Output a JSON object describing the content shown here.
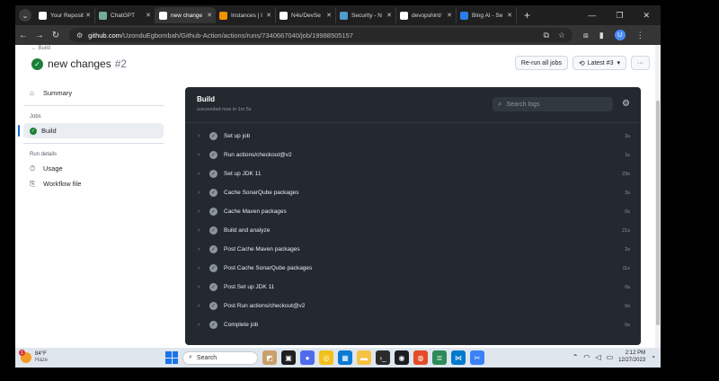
{
  "browser": {
    "tabs": [
      {
        "title": "Your Reposit",
        "favicon": "github-icon",
        "fav_color": "#ffffff",
        "active": false
      },
      {
        "title": "ChatGPT",
        "favicon": "chatgpt-icon",
        "fav_color": "#74aa9c",
        "active": false
      },
      {
        "title": "new change",
        "favicon": "github-icon",
        "fav_color": "#ffffff",
        "active": true
      },
      {
        "title": "Instances | I",
        "favicon": "aws-icon",
        "fav_color": "#f29100",
        "active": false
      },
      {
        "title": "N4s/DevSe",
        "favicon": "github-icon",
        "fav_color": "#ffffff",
        "active": false
      },
      {
        "title": "Security - N",
        "favicon": "sonarqube-icon",
        "fav_color": "#4e9bcd",
        "active": false
      },
      {
        "title": "devopshint/",
        "favicon": "github-icon",
        "fav_color": "#ffffff",
        "active": false
      },
      {
        "title": "Bing AI - Se",
        "favicon": "bing-search-icon",
        "fav_color": "#2b7de9",
        "active": false
      }
    ],
    "url_host": "github.com",
    "url_path": "/UzonduEgbombah/Github-Action/actions/runs/7340667040/job/19988505157",
    "profile_initial": "U"
  },
  "page": {
    "breadcrumb": "← Build",
    "title": "new changes",
    "run_number": "#2",
    "rerun_label": "Re-run all jobs",
    "latest_label": "Latest #3",
    "more_label": "···"
  },
  "sidebar": {
    "summary": "Summary",
    "jobs_heading": "Jobs",
    "job_build": "Build",
    "run_details_heading": "Run details",
    "usage": "Usage",
    "workflow_file": "Workflow file"
  },
  "log": {
    "title": "Build",
    "subtitle": "succeeded now in 1m 5s",
    "search_placeholder": "Search logs",
    "steps": [
      {
        "name": "Set up job",
        "duration": "2s"
      },
      {
        "name": "Run actions/checkout@v2",
        "duration": "1s"
      },
      {
        "name": "Set up JDK 11",
        "duration": "23s"
      },
      {
        "name": "Cache SonarQube packages",
        "duration": "3s"
      },
      {
        "name": "Cache Maven packages",
        "duration": "0s"
      },
      {
        "name": "Build and analyze",
        "duration": "21s"
      },
      {
        "name": "Post Cache Maven packages",
        "duration": "2s"
      },
      {
        "name": "Post Cache SonarQube packages",
        "duration": "11s"
      },
      {
        "name": "Post Set up JDK 11",
        "duration": "0s"
      },
      {
        "name": "Post Run actions/checkout@v2",
        "duration": "0s"
      },
      {
        "name": "Complete job",
        "duration": "0s"
      }
    ]
  },
  "taskbar": {
    "temperature": "84°F",
    "condition": "Haze",
    "weather_badge": "1",
    "search_label": "Search",
    "time": "2:12 PM",
    "date": "12/27/2023"
  },
  "colors": {
    "success_green": "#1a7f37",
    "log_bg": "#24292f",
    "accent_blue": "#0969da"
  }
}
